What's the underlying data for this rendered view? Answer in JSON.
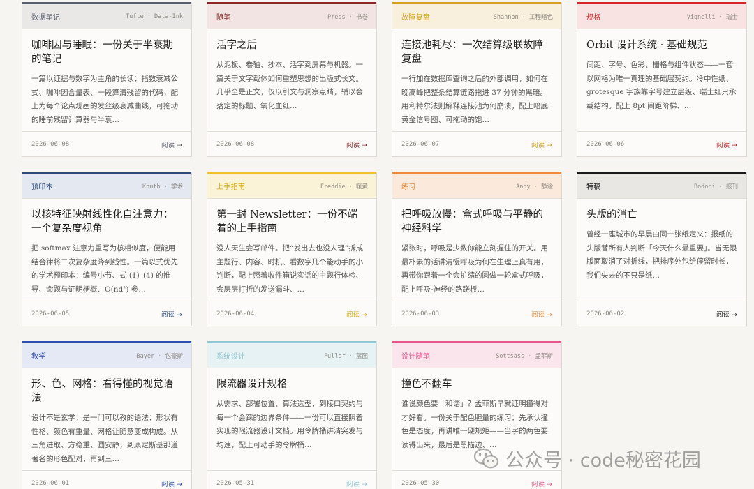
{
  "read_label": "阅读",
  "read_arrow": "→",
  "cards": [
    {
      "tag": "数据笔记",
      "meta": "Tufte · Data-Ink",
      "color": "#5a6170",
      "tagBg": "#e9e8e6",
      "title": "咖啡因与睡眠：一份关于半衰期的笔记",
      "excerpt": "一篇以证据与数字为主角的长读：指数衰减公式、咖啡因含量表、一段算清残留的代码，配上为每个论点观画的发丝级衰减曲线，可拖动的睡前残留计算器与半衰…",
      "date": "2026-06-08"
    },
    {
      "tag": "随笔",
      "meta": "Press · 书卷",
      "color": "#8a2a2a",
      "tagBg": "#f2e4e2",
      "title": "活字之后",
      "excerpt": "从泥板、卷轴、抄本、活字到屏幕与机器。一篇关于文字载体如何重塑思想的出版式长文。几乎全是正文，仅以引文与洞察点睛，辅以会落定的标题、氧化血红…",
      "date": "2026-06-08"
    },
    {
      "tag": "故障复盘",
      "meta": "Shannon · 工程暗色",
      "color": "#d4a017",
      "tagBg": "#f8f0dc",
      "title": "连接池耗尽：一次结算级联故障复盘",
      "excerpt": "一行加在数据库查询之后的外部调用，如何在晚高峰把整条结算链路拖进 37 分钟的黑暗。用利特尔法则解释连接池为何崩溃，配上暗底黄金信号图、可拖动的饱…",
      "date": "2026-06-07"
    },
    {
      "tag": "规格",
      "meta": "Vignelli · 瑞士",
      "color": "#d9262c",
      "tagBg": "#f8e3e2",
      "title": "Orbit 设计系统 · 基础规范",
      "excerpt": "间距、字号、色彩、栅格与组件状态——一套以网格为唯一真理的基础层契约。冷中性纸、grotesque 字族靠字号建立层级、瑞士红只承载结构。配上 8pt 间距阶梯、…",
      "date": "2026-06-06"
    },
    {
      "tag": "预印本",
      "meta": "Knuth · 学术",
      "color": "#2b4a7a",
      "tagBg": "#e4e9f1",
      "title": "以核特征映射线性化自注意力：一个复杂度视角",
      "excerpt": "把 softmax 注意力重写为核相似度，便能用结合律将二次复杂度降到线性。一篇以式优先的学术预印本：编号小节、式 (1)–(4) 的推导、命题与证明梗概、O(nd²) 参…",
      "date": "2026-06-05"
    },
    {
      "tag": "上手指南",
      "meta": "Freddie · 暖黄",
      "color": "#f2c12e",
      "tagBg": "#fbf3d8",
      "title": "第一封 Newsletter：一份不端着的上手指南",
      "excerpt": "没人天生会写邮件。把“发出去也没人理”拆成主题行、内容、时机、看数字几个能动手的小判断，配上照着收件箱说实话的主题行体检、会层层打折的发送漏斗、…",
      "date": "2026-06-04"
    },
    {
      "tag": "练习",
      "meta": "Andy · 静谧",
      "color": "#ef8a3c",
      "tagBg": "#fbeadb",
      "title": "把呼吸放慢：盒式呼吸与平静的神经科学",
      "excerpt": "紧张时，呼吸是少数你能立刻握住的开关。用最朴素的话讲清慢呼吸为何在生理上真有用，再带你跟着一个会扩缩的圆做一轮盒式呼吸，配上呼吸-神经的路跷板…",
      "date": "2026-06-03"
    },
    {
      "tag": "特稿",
      "meta": "Bodoni · 报刊",
      "color": "#1a1a1a",
      "tagBg": "#e8e7e4",
      "title": "头版的消亡",
      "excerpt": "曾经一座城市的早晨由同一张纸定义：报纸的头版替所有人判断「今天什么最重要」。当无限版面取消了对折线，把排序外包给停留时长，我们失去的不只是纸…",
      "date": "2026-06-02"
    },
    {
      "tag": "教学",
      "meta": "Bayer · 包豪斯",
      "color": "#2f4fb2",
      "tagBg": "#e5e9f6",
      "title": "形、色、网格：看得懂的视觉语法",
      "excerpt": "设计不是玄学，是一门可以教的语法：形状有性格、颜色有重量、网格让随意变成构成。从三角进取、方稳重、圆安静，到康定斯基那道著名的形色配对，再到三…",
      "date": "2026-06-01"
    },
    {
      "tag": "系统设计",
      "meta": "Fuller · 蓝图",
      "color": "#8fc7d3",
      "tagBg": "#e6f2f4",
      "title": "限流器设计规格",
      "excerpt": "从需求、部署位置、算法选型，到接口契约与每一个会踩的边界条件——一份可以直接照着实现的限流器设计文档。用令牌桶讲清突发与均速，配上可动手的令牌桶…",
      "date": "2026-05-31"
    },
    {
      "tag": "设计随笔",
      "meta": "Sottsass · 孟菲斯",
      "color": "#e8558a",
      "tagBg": "#fbe5ec",
      "title": "撞色不翻车",
      "excerpt": "谁说颜色要「和谐」？孟菲斯早就证明撞得对才好看。一份关于配色胆量的练习：先承认撞色是态度，再讲唯一硬规矩——当字的两色要读得出来，最后是黑描边、…",
      "date": "2026-05-30"
    }
  ],
  "watermark": {
    "text": "公众号 · code秘密花园",
    "icon": "wechat-icon"
  }
}
